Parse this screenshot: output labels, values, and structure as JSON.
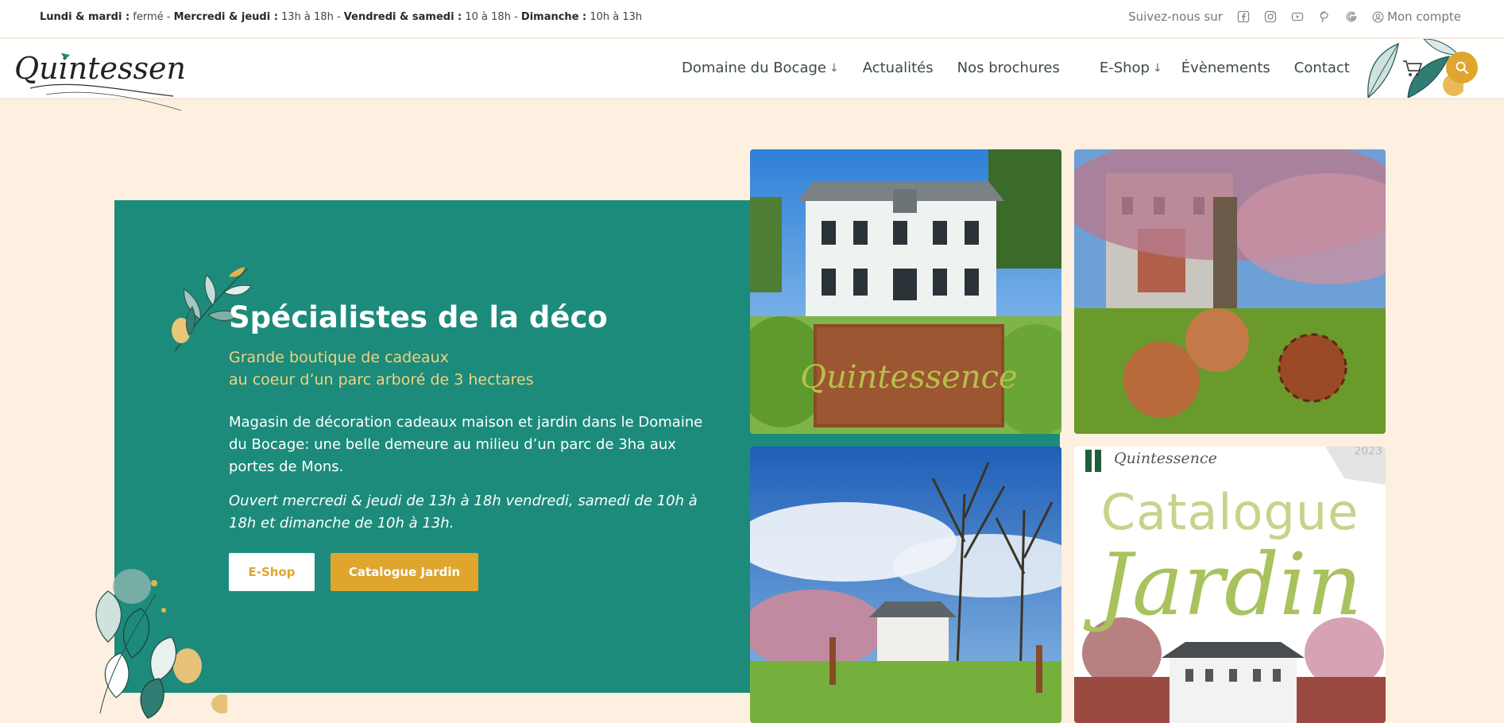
{
  "topbar": {
    "hours": [
      {
        "day": "Lundi & mardi :",
        "time": " fermé - "
      },
      {
        "day": "Mercredi & jeudi :",
        "time": " 13h à 18h - "
      },
      {
        "day": "Vendredi & samedi :",
        "time": " 10 à 18h - "
      },
      {
        "day": "Dimanche :",
        "time": " 10h à 13h"
      }
    ],
    "follow_label": "Suivez-nous sur",
    "social_icons": [
      "facebook-icon",
      "instagram-icon",
      "youtube-icon",
      "pinterest-icon",
      "google-icon"
    ],
    "account_label": "Mon compte"
  },
  "header": {
    "logo_text": "Quintessence",
    "nav": [
      {
        "label": "Domaine du Bocage",
        "dropdown": true
      },
      {
        "label": "Actualités",
        "dropdown": false
      },
      {
        "label": "Nos brochures",
        "dropdown": false
      },
      {
        "label": "E-Shop",
        "dropdown": true
      },
      {
        "label": "Évènements",
        "dropdown": false
      },
      {
        "label": "Contact",
        "dropdown": false
      }
    ]
  },
  "hero": {
    "title": "Spécialistes de la déco",
    "subtitle_line1": "Grande boutique de cadeaux",
    "subtitle_line2": "au coeur d’un parc arboré de 3 hectares",
    "description": "Magasin de décoration cadeaux maison et jardin dans le Domaine du Bocage: une belle demeure au milieu d’un parc de 3ha aux portes de Mons.",
    "hours_text": "Ouvert mercredi & jeudi de 13h à 18h vendredi, samedi de 10h à 18h et dimanche de 10h à 13h.",
    "btn_eshop": "E-Shop",
    "btn_catalogue": "Catalogue Jardin"
  },
  "catalogue": {
    "brand": "Quintessence",
    "year": "2023",
    "title": "Catalogue",
    "subtitle": "Jardin"
  },
  "colors": {
    "teal": "#1c8b7b",
    "gold": "#e0a52d",
    "cream": "#fdf0e0",
    "subtitle": "#f2d27f"
  }
}
